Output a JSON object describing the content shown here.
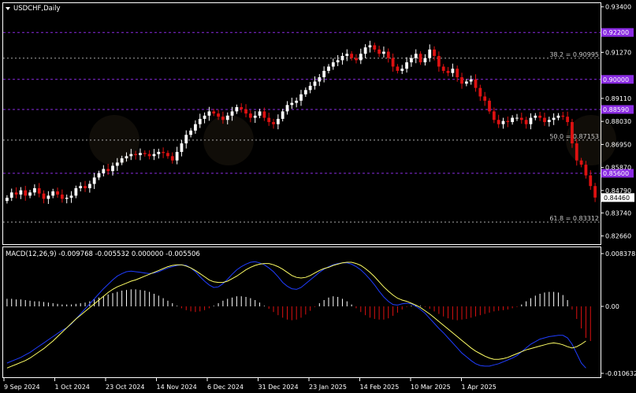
{
  "header": {
    "symbol_label": "USDCHF,Daily",
    "macd_label": "MACD(12,26,9) -0.009768 -0.005532 0.000000 -0.005506"
  },
  "price_axis": {
    "ticks": [
      "0.93400",
      "0.91270",
      "0.89110",
      "0.88030",
      "0.86950",
      "0.85870",
      "0.84790",
      "0.83740",
      "0.82660"
    ],
    "current_price": "0.84460"
  },
  "macd_axis": {
    "ticks": [
      "0.008378",
      "0.00",
      "-0.010632"
    ]
  },
  "levels": [
    {
      "label": "0.92200",
      "value": 0.922,
      "kind": "tag"
    },
    {
      "label": "38.2 = 0.90995",
      "value": 0.90995,
      "kind": "fib"
    },
    {
      "label": "0.90000",
      "value": 0.9,
      "kind": "tag"
    },
    {
      "label": "0.88590",
      "value": 0.8859,
      "kind": "tag"
    },
    {
      "label": "50.0 = 0.87153",
      "value": 0.87153,
      "kind": "fib"
    },
    {
      "label": "0.85600",
      "value": 0.856,
      "kind": "tag"
    },
    {
      "label": "61.8 = 0.83312",
      "value": 0.83312,
      "kind": "fib"
    }
  ],
  "x_labels": [
    "9 Sep 2024",
    "1 Oct 2024",
    "23 Oct 2024",
    "14 Nov 2024",
    "6 Dec 2024",
    "31 Dec 2024",
    "23 Jan 2025",
    "14 Feb 2025",
    "10 Mar 2025",
    "1 Apr 2025"
  ],
  "colors": {
    "bull": "#ffffff",
    "bear": "#dd1111",
    "tag_line": "#8a2be2",
    "fib_line": "#aaaaaa",
    "macd_line": "#1f3dff",
    "signal_line": "#ffff66",
    "current_tag_bg": "#ffffff"
  },
  "chart_data": [
    {
      "type": "candlestick",
      "title": "USDCHF,Daily",
      "ylim": [
        0.8235,
        0.935
      ],
      "x_ticks": [
        "9 Sep 2024",
        "1 Oct 2024",
        "23 Oct 2024",
        "14 Nov 2024",
        "6 Dec 2024",
        "31 Dec 2024",
        "23 Jan 2025",
        "14 Feb 2025",
        "10 Mar 2025",
        "1 Apr 2025"
      ],
      "close": [
        0.8445,
        0.847,
        0.846,
        0.848,
        0.8455,
        0.847,
        0.849,
        0.8465,
        0.844,
        0.8455,
        0.8475,
        0.846,
        0.844,
        0.8445,
        0.8455,
        0.849,
        0.85,
        0.849,
        0.851,
        0.854,
        0.856,
        0.858,
        0.857,
        0.8595,
        0.861,
        0.863,
        0.864,
        0.865,
        0.8645,
        0.8655,
        0.865,
        0.864,
        0.865,
        0.866,
        0.8655,
        0.864,
        0.862,
        0.866,
        0.87,
        0.874,
        0.876,
        0.879,
        0.8815,
        0.883,
        0.885,
        0.884,
        0.8825,
        0.881,
        0.883,
        0.885,
        0.887,
        0.886,
        0.884,
        0.882,
        0.883,
        0.885,
        0.882,
        0.88,
        0.879,
        0.8815,
        0.885,
        0.888,
        0.889,
        0.89,
        0.893,
        0.895,
        0.897,
        0.899,
        0.901,
        0.904,
        0.906,
        0.908,
        0.909,
        0.911,
        0.912,
        0.91,
        0.909,
        0.912,
        0.915,
        0.916,
        0.914,
        0.912,
        0.913,
        0.91,
        0.906,
        0.904,
        0.905,
        0.908,
        0.91,
        0.912,
        0.908,
        0.91,
        0.914,
        0.911,
        0.906,
        0.904,
        0.903,
        0.905,
        0.901,
        0.898,
        0.899,
        0.9,
        0.896,
        0.892,
        0.89,
        0.885,
        0.881,
        0.879,
        0.8805,
        0.88,
        0.882,
        0.882,
        0.881,
        0.879,
        0.882,
        0.883,
        0.882,
        0.88,
        0.881,
        0.882,
        0.883,
        0.8825,
        0.88,
        0.87,
        0.862,
        0.86,
        0.855,
        0.85,
        0.8446
      ]
    },
    {
      "type": "macd",
      "title": "MACD(12,26,9)",
      "ylim": [
        -0.010632,
        0.008378
      ],
      "histogram": [
        0.0012,
        0.0012,
        0.0011,
        0.0011,
        0.001,
        0.0009,
        0.0008,
        0.0008,
        0.0007,
        0.0006,
        0.0005,
        0.0004,
        0.0003,
        0.0003,
        0.0003,
        0.0004,
        0.0005,
        0.0006,
        0.0008,
        0.0011,
        0.0014,
        0.0016,
        0.0019,
        0.0021,
        0.0023,
        0.0025,
        0.0026,
        0.0027,
        0.0027,
        0.0026,
        0.0025,
        0.0023,
        0.002,
        0.0017,
        0.0013,
        0.0009,
        0.0005,
        0.0001,
        -0.0003,
        -0.0006,
        -0.0008,
        -0.0009,
        -0.0008,
        -0.0006,
        -0.0003,
        0.0001,
        0.0005,
        0.0009,
        0.0012,
        0.0014,
        0.0016,
        0.0016,
        0.0015,
        0.0013,
        0.001,
        0.0006,
        0.0001,
        -0.0004,
        -0.0009,
        -0.0014,
        -0.0018,
        -0.0021,
        -0.0022,
        -0.0021,
        -0.0018,
        -0.0013,
        -0.0007,
        -0.0001,
        0.0005,
        0.001,
        0.0014,
        0.0016,
        0.0015,
        0.0012,
        0.0008,
        0.0003,
        -0.0003,
        -0.0009,
        -0.0014,
        -0.0018,
        -0.002,
        -0.0021,
        -0.0021,
        -0.0019,
        -0.0015,
        -0.001,
        -0.0005,
        -0.0001,
        0.0001,
        0.0002,
        0.0001,
        -0.0001,
        -0.0004,
        -0.0008,
        -0.0012,
        -0.0016,
        -0.0019,
        -0.0021,
        -0.0022,
        -0.0021,
        -0.002,
        -0.0018,
        -0.0016,
        -0.0014,
        -0.0012,
        -0.001,
        -0.0008,
        -0.0007,
        -0.0006,
        -0.0005,
        -0.0003,
        -0.0001,
        0.0003,
        0.0008,
        0.0013,
        0.0017,
        0.002,
        0.0022,
        0.0023,
        0.0023,
        0.0022,
        0.0018,
        0.001,
        -0.0005,
        -0.002,
        -0.0035,
        -0.005,
        -0.0055
      ],
      "macd": [
        -0.009,
        -0.0087,
        -0.0084,
        -0.0081,
        -0.0077,
        -0.0073,
        -0.0068,
        -0.0063,
        -0.0058,
        -0.0053,
        -0.0048,
        -0.0043,
        -0.0038,
        -0.0034,
        -0.0028,
        -0.002,
        -0.0012,
        -0.0004,
        0.0004,
        0.0012,
        0.002,
        0.0028,
        0.0035,
        0.0042,
        0.0048,
        0.0052,
        0.0055,
        0.0056,
        0.0055,
        0.0054,
        0.0053,
        0.0052,
        0.0053,
        0.0055,
        0.0058,
        0.0061,
        0.0063,
        0.0065,
        0.0066,
        0.0065,
        0.0061,
        0.0055,
        0.0047,
        0.004,
        0.0034,
        0.003,
        0.0031,
        0.0036,
        0.0043,
        0.0051,
        0.0058,
        0.0063,
        0.0067,
        0.007,
        0.0071,
        0.0069,
        0.0066,
        0.0061,
        0.0055,
        0.0047,
        0.0038,
        0.0032,
        0.0028,
        0.0027,
        0.003,
        0.0036,
        0.0042,
        0.0048,
        0.0054,
        0.0059,
        0.0063,
        0.0066,
        0.0068,
        0.0069,
        0.0069,
        0.0067,
        0.0063,
        0.0058,
        0.0051,
        0.0043,
        0.0034,
        0.0024,
        0.0015,
        0.0008,
        0.0003,
        0.0002,
        0.0004,
        0.0005,
        0.0004,
        0.0,
        -0.0005,
        -0.0011,
        -0.0019,
        -0.0027,
        -0.0035,
        -0.0042,
        -0.005,
        -0.0058,
        -0.0066,
        -0.0074,
        -0.008,
        -0.0086,
        -0.0091,
        -0.0094,
        -0.0095,
        -0.0095,
        -0.0093,
        -0.0091,
        -0.0088,
        -0.0085,
        -0.0082,
        -0.0078,
        -0.0072,
        -0.0066,
        -0.006,
        -0.0056,
        -0.0052,
        -0.005,
        -0.0048,
        -0.0047,
        -0.0046,
        -0.0046,
        -0.005,
        -0.006,
        -0.0075,
        -0.009,
        -0.0098
      ],
      "signal": [
        -0.0098,
        -0.0095,
        -0.0092,
        -0.0089,
        -0.0086,
        -0.0082,
        -0.0077,
        -0.0072,
        -0.0067,
        -0.0061,
        -0.0055,
        -0.0048,
        -0.0041,
        -0.0034,
        -0.0027,
        -0.002,
        -0.0014,
        -0.0008,
        -0.0002,
        0.0004,
        0.001,
        0.0016,
        0.0022,
        0.0027,
        0.0031,
        0.0034,
        0.0037,
        0.004,
        0.0042,
        0.0045,
        0.0048,
        0.0051,
        0.0054,
        0.0057,
        0.006,
        0.0063,
        0.0065,
        0.0066,
        0.0066,
        0.0064,
        0.0061,
        0.0057,
        0.0052,
        0.0047,
        0.0042,
        0.0039,
        0.0038,
        0.0038,
        0.004,
        0.0044,
        0.0048,
        0.0053,
        0.0058,
        0.0062,
        0.0065,
        0.0067,
        0.0068,
        0.0068,
        0.0066,
        0.0063,
        0.0059,
        0.0054,
        0.0049,
        0.0046,
        0.0045,
        0.0046,
        0.0049,
        0.0053,
        0.0057,
        0.006,
        0.0062,
        0.0065,
        0.0067,
        0.0069,
        0.007,
        0.007,
        0.0068,
        0.0065,
        0.006,
        0.0054,
        0.0047,
        0.0039,
        0.0031,
        0.0024,
        0.0018,
        0.0013,
        0.001,
        0.0008,
        0.0005,
        0.0002,
        -0.0002,
        -0.0007,
        -0.0012,
        -0.0018,
        -0.0024,
        -0.003,
        -0.0036,
        -0.0042,
        -0.0048,
        -0.0054,
        -0.006,
        -0.0066,
        -0.0071,
        -0.0075,
        -0.0079,
        -0.0082,
        -0.0084,
        -0.0084,
        -0.0083,
        -0.0081,
        -0.0078,
        -0.0075,
        -0.0072,
        -0.0069,
        -0.0067,
        -0.0065,
        -0.0063,
        -0.0061,
        -0.0059,
        -0.0058,
        -0.0059,
        -0.0061,
        -0.0064,
        -0.0066,
        -0.0064,
        -0.006,
        -0.0055
      ]
    }
  ]
}
